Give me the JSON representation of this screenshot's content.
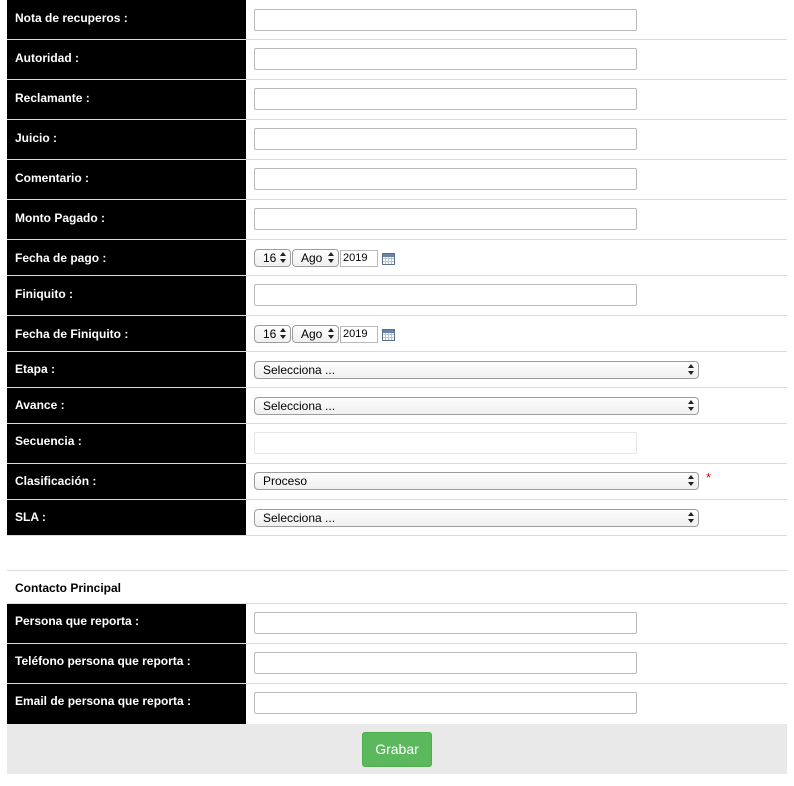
{
  "form": {
    "recuperos_label": "Nota de recuperos :",
    "autoridad_label": "Autoridad :",
    "reclamante_label": "Reclamante :",
    "juicio_label": "Juicio :",
    "comentario_label": "Comentario :",
    "monto_label": "Monto Pagado :",
    "fecha_pago_label": "Fecha de pago :",
    "fecha_pago": {
      "day": "16",
      "month": "Ago",
      "year": "2019"
    },
    "finiquito_label": "Finiquito :",
    "fecha_finiquito_label": "Fecha de Finiquito :",
    "fecha_finiquito": {
      "day": "16",
      "month": "Ago",
      "year": "2019"
    },
    "etapa_label": "Etapa :",
    "etapa_value": "Selecciona ...",
    "avance_label": "Avance :",
    "avance_value": "Selecciona ...",
    "secuencia_label": "Secuencia :",
    "clasificacion_label": "Clasificación :",
    "clasificacion_value": "Proceso",
    "required_mark": "*",
    "sla_label": "SLA :",
    "sla_value": "Selecciona ..."
  },
  "contacto": {
    "title": "Contacto Principal",
    "persona_label": "Persona que reporta :",
    "telefono_label": "Teléfono persona que reporta :",
    "email_label": "Email de persona que reporta :"
  },
  "footer": {
    "save_label": "Grabar"
  },
  "colors": {
    "label_bg": "#000000",
    "button_bg": "#5cb85c",
    "footer_bg": "#e9e9e9",
    "required": "#e00000"
  }
}
